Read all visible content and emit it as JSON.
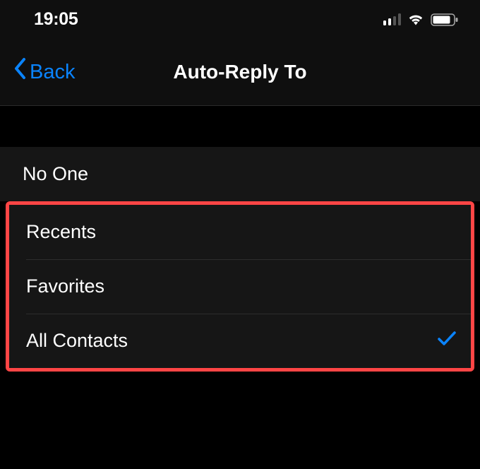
{
  "statusBar": {
    "time": "19:05"
  },
  "nav": {
    "back_label": "Back",
    "title": "Auto-Reply To"
  },
  "options": {
    "no_one": "No One",
    "recents": "Recents",
    "favorites": "Favorites",
    "all_contacts": "All Contacts",
    "selected": "all_contacts"
  }
}
